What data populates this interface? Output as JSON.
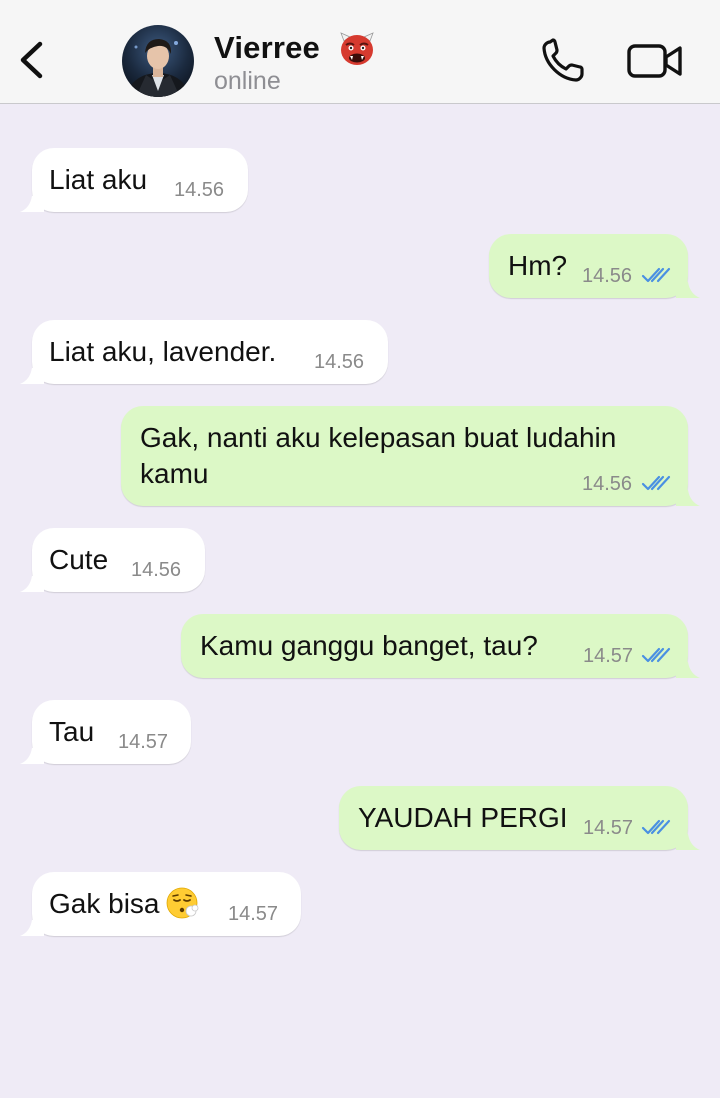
{
  "header": {
    "contact_name": "Vierree",
    "name_emoji_icon": "ogre-emoji",
    "status": "online",
    "back_icon": "chevron-left-icon",
    "call_icon": "phone-icon",
    "video_icon": "video-camera-icon"
  },
  "colors": {
    "chat_background": "#efebf6",
    "incoming_bubble": "#ffffff",
    "outgoing_bubble": "#dcf8c6",
    "read_ticks": "#4a90e2"
  },
  "messages": [
    {
      "direction": "in",
      "text": "Liat aku",
      "time": "14.56"
    },
    {
      "direction": "out",
      "text": "Hm?",
      "time": "14.56",
      "status": "read"
    },
    {
      "direction": "in",
      "text": "Liat aku, lavender.",
      "time": "14.56"
    },
    {
      "direction": "out",
      "text_line1": "Gak, nanti aku kelepasan buat ludahin",
      "text_line2": "kamu",
      "time": "14.56",
      "status": "read"
    },
    {
      "direction": "in",
      "text": "Cute",
      "time": "14.56"
    },
    {
      "direction": "out",
      "text": "Kamu ganggu banget, tau?",
      "time": "14.57",
      "status": "read"
    },
    {
      "direction": "in",
      "text": "Tau",
      "time": "14.57"
    },
    {
      "direction": "out",
      "text": "YAUDAH PERGI",
      "time": "14.57",
      "status": "read"
    },
    {
      "direction": "in",
      "text": "Gak bisa",
      "emoji_icon": "face-exhaling-emoji",
      "time": "14.57"
    }
  ]
}
